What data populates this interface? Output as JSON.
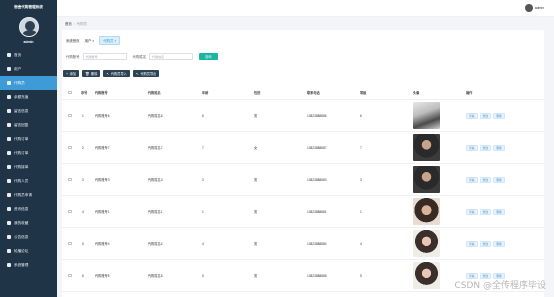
{
  "app": {
    "title": "宿舍代购管理系统",
    "username": "admin"
  },
  "sidebar": {
    "items": [
      {
        "label": "首页",
        "active": false
      },
      {
        "label": "用户",
        "active": false
      },
      {
        "label": "代购员",
        "active": true
      },
      {
        "label": "余额充值",
        "active": false
      },
      {
        "label": "留言信息",
        "active": false
      },
      {
        "label": "留言回复",
        "active": false
      },
      {
        "label": "代购订单",
        "active": false
      },
      {
        "label": "代购订单",
        "active": false
      },
      {
        "label": "代购接单",
        "active": false
      },
      {
        "label": "代购人员",
        "active": false
      },
      {
        "label": "代购员申请",
        "active": false
      },
      {
        "label": "资讯信息",
        "active": false
      },
      {
        "label": "我的收藏",
        "active": false
      },
      {
        "label": "公告信息",
        "active": false
      },
      {
        "label": "轮播论坛",
        "active": false
      },
      {
        "label": "系统管理",
        "active": false
      }
    ]
  },
  "header": {
    "user": "admin"
  },
  "breadcrumb": {
    "home": "首页",
    "current": "代购员"
  },
  "tabs": [
    {
      "label": "系统首页",
      "active": false
    },
    {
      "label": "用户 ×",
      "active": false
    },
    {
      "label": "代购员 ×",
      "active": true
    }
  ],
  "search": {
    "field1_label": "代购账号",
    "field1_placeholder": "代购账号",
    "field2_label": "代购姓名",
    "field2_placeholder": "代购姓名",
    "button": "查询"
  },
  "actions": [
    {
      "label": "添加",
      "icon": "+"
    },
    {
      "label": "删除",
      "icon": "🗑"
    },
    {
      "label": "代购员导入",
      "icon": "↖"
    },
    {
      "label": "代购员导出",
      "icon": "↖"
    }
  ],
  "table": {
    "headers": [
      "序号",
      "代购账号",
      "代购姓名",
      "年龄",
      "性别",
      "联系电话",
      "等级",
      "头像",
      "操作"
    ],
    "rows": [
      {
        "no": "1",
        "account": "代购账号6",
        "name": "代购姓名6",
        "age": "6",
        "gender": "男",
        "phone": "13823888886",
        "level": "6",
        "photo": "bw"
      },
      {
        "no": "2",
        "account": "代购账号7",
        "name": "代购姓名7",
        "age": "7",
        "gender": "女",
        "phone": "13823888887",
        "level": "7",
        "photo": "dark"
      },
      {
        "no": "3",
        "account": "代购账号3",
        "name": "代购姓名3",
        "age": "3",
        "gender": "男",
        "phone": "13823888883",
        "level": "3",
        "photo": "dark"
      },
      {
        "no": "4",
        "account": "代购账号1",
        "name": "代购姓名1",
        "age": "1",
        "gender": "男",
        "phone": "13823888881",
        "level": "1",
        "photo": "warm"
      },
      {
        "no": "5",
        "account": "代购账号4",
        "name": "代购姓名4",
        "age": "4",
        "gender": "男",
        "phone": "13823888884",
        "level": "4",
        "photo": "light"
      },
      {
        "no": "6",
        "account": "代购账号5",
        "name": "代购姓名5",
        "age": "5",
        "gender": "男",
        "phone": "13823888885",
        "level": "5",
        "photo": "light"
      }
    ],
    "op_labels": [
      "查看",
      "修改",
      "删除"
    ]
  },
  "watermark": "CSDN @全传程序毕设"
}
